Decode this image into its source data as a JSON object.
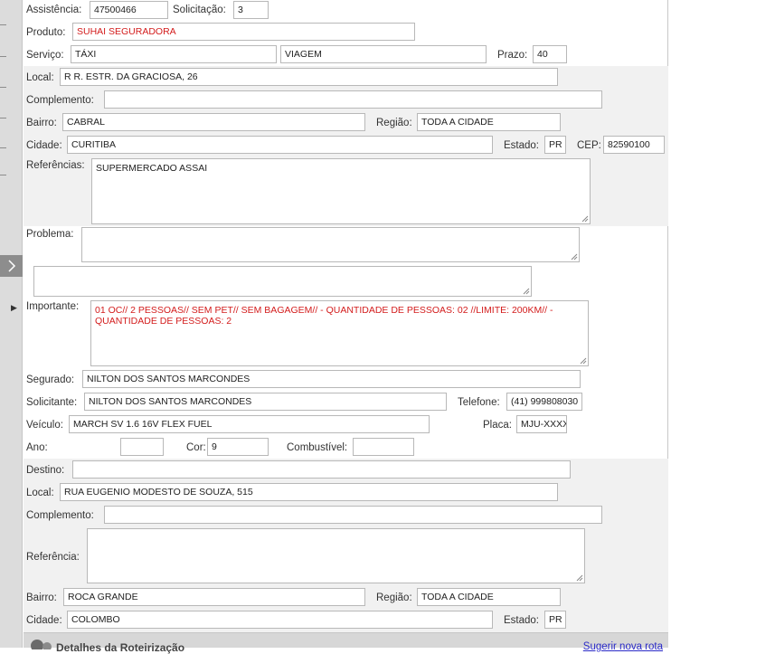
{
  "assistencia": {
    "label": "Assistência:",
    "value": "47500466"
  },
  "solicitacao": {
    "label": "Solicitação:",
    "value": "3"
  },
  "produto": {
    "label": "Produto:",
    "value": "SUHAI SEGURADORA",
    "color": "#d31c1c"
  },
  "servico": {
    "label": "Serviço:",
    "value": "TÁXI",
    "value2": "VIAGEM"
  },
  "prazo": {
    "label": "Prazo:",
    "value": "40"
  },
  "local": {
    "label": "Local:",
    "value": "R R. ESTR. DA GRACIOSA, 26"
  },
  "complemento": {
    "label": "Complemento:",
    "value": ""
  },
  "bairro": {
    "label": "Bairro:",
    "value": "CABRAL"
  },
  "regiao": {
    "label": "Região:",
    "value": "TODA A CIDADE"
  },
  "cidade": {
    "label": "Cidade:",
    "value": "CURITIBA"
  },
  "estado": {
    "label": "Estado:",
    "value": "PR"
  },
  "cep": {
    "label": "CEP:",
    "value": "82590100"
  },
  "referencias": {
    "label": "Referências:",
    "value": "SUPERMERCADO ASSAI"
  },
  "problema": {
    "label": "Problema:",
    "value": "",
    "extra_value": ""
  },
  "importante": {
    "label": "Importante:",
    "value": "01 OC// 2 PESSOAS// SEM PET// SEM BAGAGEM// - QUANTIDADE DE PESSOAS: 02 //LIMITE: 200KM// - QUANTIDADE DE PESSOAS: 2",
    "color": "#d31c1c"
  },
  "segurado": {
    "label": "Segurado:",
    "value": "NILTON DOS SANTOS MARCONDES"
  },
  "solicitante": {
    "label": "Solicitante:",
    "value": "NILTON DOS SANTOS MARCONDES"
  },
  "telefone": {
    "label": "Telefone:",
    "value": "(41) 999808030"
  },
  "veiculo": {
    "label": "Veículo:",
    "value": "MARCH SV 1.6 16V FLEX FUEL"
  },
  "placa": {
    "label": "Placa:",
    "value": "MJU-XXXX"
  },
  "ano": {
    "label": "Ano:",
    "value": ""
  },
  "cor": {
    "label": "Cor:",
    "value": "9"
  },
  "combustivel": {
    "label": "Combustível:",
    "value": ""
  },
  "destino": {
    "label": "Destino:",
    "value": "",
    "local_label": "Local:",
    "local_value": "RUA EUGENIO MODESTO DE SOUZA, 515",
    "complemento_label": "Complemento:",
    "complemento_value": "",
    "referencia_label": "Referência:",
    "referencia_value": "",
    "bairro_label": "Bairro:",
    "bairro_value": "ROCA GRANDE",
    "regiao_label": "Região:",
    "regiao_value": "TODA A CIDADE",
    "cidade_label": "Cidade:",
    "cidade_value": "COLOMBO",
    "estado_label": "Estado:",
    "estado_value": "PR"
  },
  "footer": {
    "title": "Detalhes da Roteirização",
    "link": "Sugerir nova rota"
  },
  "sidebar": {
    "toggle_icon": "chevron-right-icon",
    "arrow_icon": "caret-right-icon"
  },
  "colors": {
    "band": "#f1f1f1",
    "sidebar": "#dcdcdc",
    "toggle": "#8d8d8d",
    "alert_text": "#d31c1c",
    "link": "#2a2ac8"
  }
}
